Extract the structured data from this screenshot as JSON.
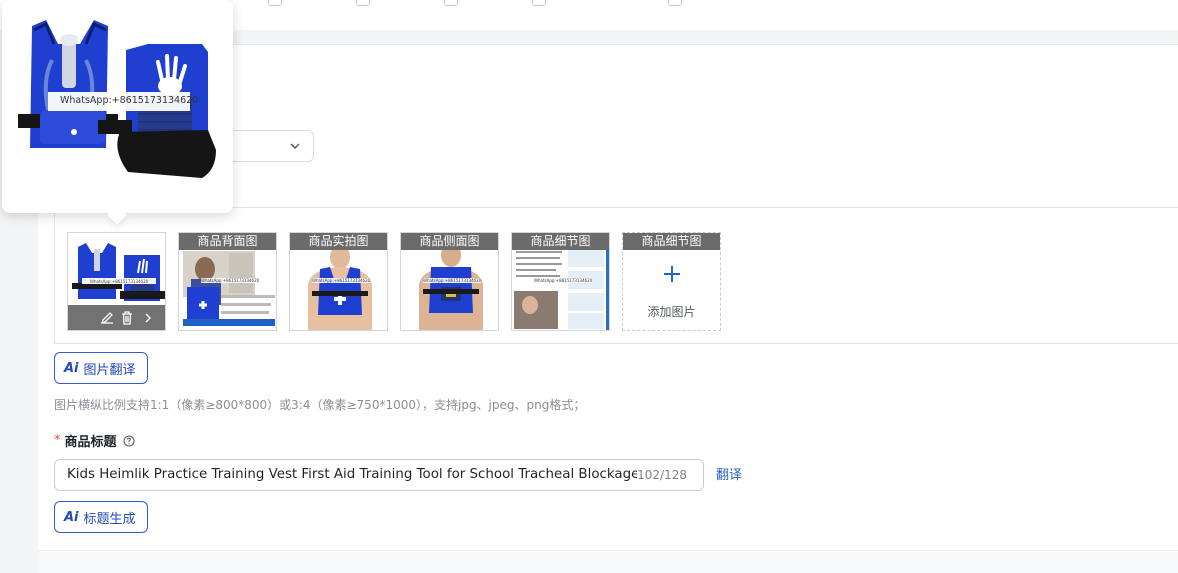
{
  "gallery": {
    "thumbs": [
      {
        "label": "",
        "image": "vest-front-and-back"
      },
      {
        "label": "商品背面图",
        "image": "vest-in-use-photo"
      },
      {
        "label": "商品实拍图",
        "image": "vest-on-mannequin-front"
      },
      {
        "label": "商品侧面图",
        "image": "vest-on-mannequin-back"
      },
      {
        "label": "商品细节图",
        "image": "instruction-sheet"
      }
    ],
    "add_slot": {
      "label": "商品细节图",
      "text": "添加图片"
    }
  },
  "watermark": "WhatsApp:+8615173134620",
  "image_translate_button": {
    "ai": "Ai",
    "label": "图片翻译"
  },
  "image_hint": "图片横纵比例支持1:1（像素≥800*800）或3:4（像素≥750*1000），支持jpg、jpeg、png格式；",
  "title_field": {
    "required_mark": "*",
    "label": "商品标题",
    "value": "Kids Heimlik Practice Training Vest First Aid Training Tool for School Tracheal Blockage Wear",
    "count": "102/128",
    "translate_link": "翻译"
  },
  "title_gen_button": {
    "ai": "Ai",
    "label": "标题生成"
  },
  "colors": {
    "accent": "#2548b8",
    "link": "#2563c9",
    "vest_blue": "#1e3fd0",
    "required": "#e34d4d"
  }
}
